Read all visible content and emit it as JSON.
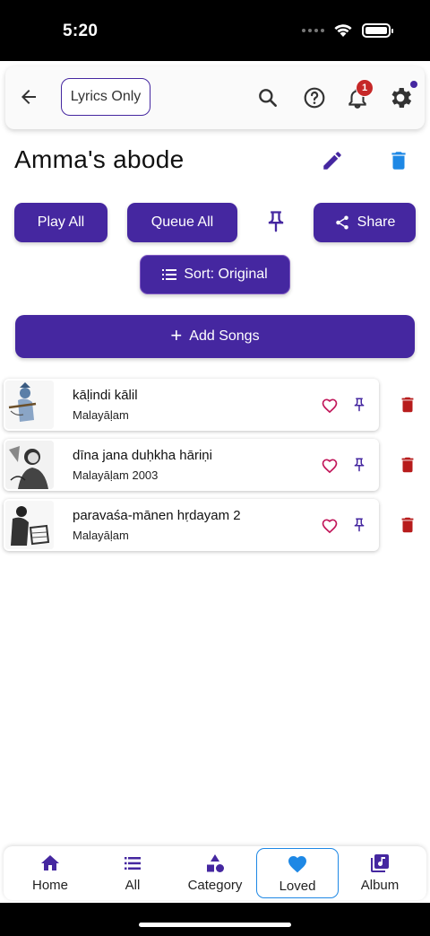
{
  "status": {
    "time": "5:20"
  },
  "header": {
    "lyrics_only_label": "Lyrics Only",
    "notification_count": "1"
  },
  "page": {
    "title": "Amma's abode"
  },
  "actions": {
    "play_all": "Play All",
    "queue_all": "Queue All",
    "share": "Share",
    "sort": "Sort: Original",
    "add_songs": "Add Songs"
  },
  "songs": [
    {
      "title": "kāḷindi kālil",
      "subtitle": "Malayāḷam"
    },
    {
      "title": "dīna jana duḥkha hāriṇi",
      "subtitle": "Malayāḷam 2003"
    },
    {
      "title": "paravaśa-mānen hṛdayam 2",
      "subtitle": "Malayāḷam"
    }
  ],
  "nav": {
    "items": [
      {
        "label": "Home",
        "icon": "home-icon"
      },
      {
        "label": "All",
        "icon": "list-icon"
      },
      {
        "label": "Category",
        "icon": "category-icon"
      },
      {
        "label": "Loved",
        "icon": "heart-icon"
      },
      {
        "label": "Album",
        "icon": "album-icon"
      }
    ],
    "active": "Loved"
  },
  "colors": {
    "primary": "#4527a0",
    "accent_blue": "#1e88e5",
    "delete_red": "#b71c1c",
    "heart_red": "#c2185b",
    "badge_red": "#c62828"
  }
}
